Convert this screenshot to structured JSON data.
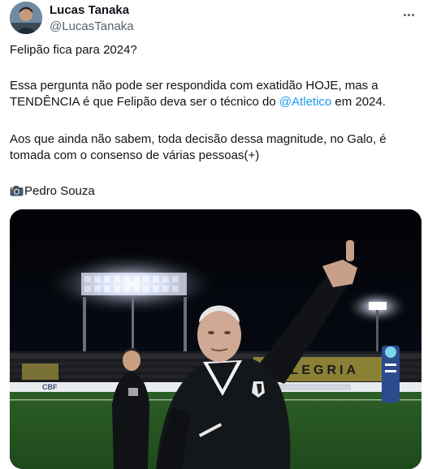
{
  "author": {
    "display_name": "Lucas Tanaka",
    "handle": "@LucasTanaka"
  },
  "tweet": {
    "line1": "Felipão fica para 2024?",
    "para2_part1": "Essa pergunta não pode ser respondida com exatidão HOJE, mas a TENDÊNCIA é que Felipão deva ser o técnico do ",
    "mention": "@Atletico",
    "para2_part2": " em 2024.",
    "para3": "Aos que ainda não sabem, toda decisão dessa magnitude, no Galo, é tomada com o consenso de várias pessoas(+)",
    "photo_credit": "Pedro Souza"
  },
  "media": {
    "stand_banner_text": "ALEGRIA",
    "ad_board_text": "CBF"
  },
  "colors": {
    "link": "#1d9bf0",
    "secondary_text": "#536471",
    "pitch": "#2f6b2a"
  }
}
